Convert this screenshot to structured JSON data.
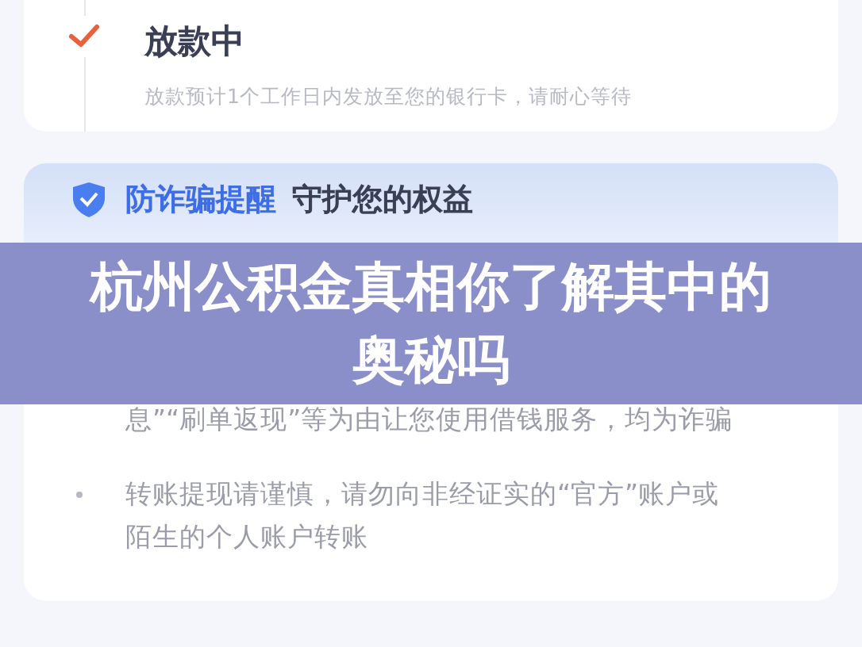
{
  "status_step": {
    "title": "放款中",
    "done": true,
    "description": "放款预计1个工作日内发放至您的银行卡，请耐心等待"
  },
  "notice": {
    "title_highlight": "防诈骗提醒",
    "title_rest": "守护您的权益",
    "items": [
      {
        "text": "息”“刷单返现”等为由让您使用借钱服务，均为诈骗",
        "bullet": false
      },
      {
        "text": "转账提现请谨慎，请勿向非经证实的“官方”账户或陌生的个人账户转账",
        "bullet": true
      }
    ]
  },
  "banner": {
    "title": "杭州公积金真相你了解其中的奥秘吗"
  }
}
